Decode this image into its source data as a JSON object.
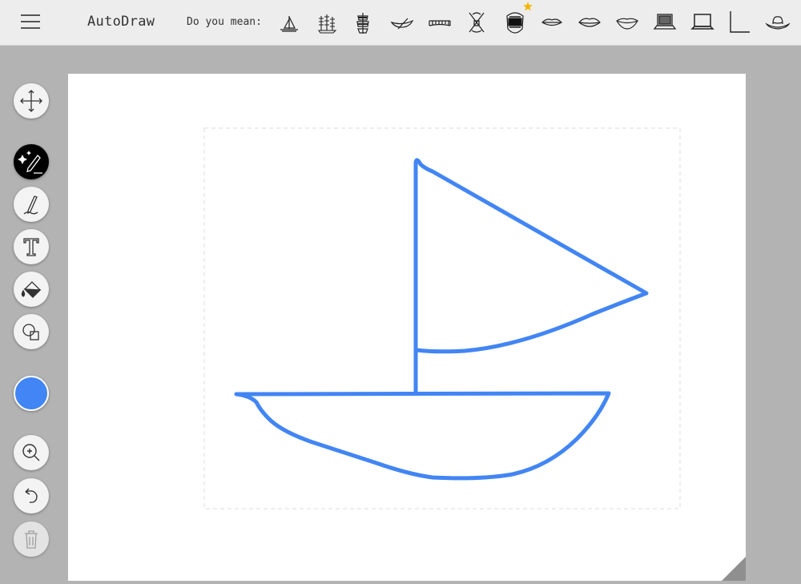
{
  "app": {
    "title": "AutoDraw"
  },
  "header": {
    "suggestions_label": "Do you mean:"
  },
  "suggestions": [
    {
      "icon": "sailboat-icon"
    },
    {
      "icon": "tall-ship-icon"
    },
    {
      "icon": "galleon-icon"
    },
    {
      "icon": "canoe-icon"
    },
    {
      "icon": "bridge-icon"
    },
    {
      "icon": "crossed-oars-icon"
    },
    {
      "icon": "open-mouth-icon",
      "featured": true
    },
    {
      "icon": "lips-icon"
    },
    {
      "icon": "closed-lips-icon"
    },
    {
      "icon": "smiling-lips-icon"
    },
    {
      "icon": "laptop-icon"
    },
    {
      "icon": "laptop-outline-icon"
    },
    {
      "icon": "corner-line-icon"
    },
    {
      "icon": "cowboy-hat-icon"
    }
  ],
  "toolbar": {
    "tools": [
      {
        "name": "move-tool",
        "icon": "move-arrows-icon"
      },
      {
        "name": "autodraw-tool",
        "icon": "magic-pen-icon",
        "active": true
      },
      {
        "name": "draw-tool",
        "icon": "pencil-icon"
      },
      {
        "name": "type-tool",
        "icon": "text-t-icon"
      },
      {
        "name": "fill-tool",
        "icon": "paint-bucket-icon"
      },
      {
        "name": "shape-tool",
        "icon": "shapes-icon"
      },
      {
        "name": "color-picker",
        "icon": "color-swatch-icon"
      },
      {
        "name": "zoom-tool",
        "icon": "zoom-in-icon"
      },
      {
        "name": "undo-button",
        "icon": "undo-icon"
      },
      {
        "name": "delete-button",
        "icon": "trash-icon",
        "disabled": true
      }
    ]
  },
  "colors": {
    "stroke": "#4285f4",
    "selected_color": "#4285f4",
    "toolbar_bg": "#ededed",
    "workspace_bg": "#b3b3b3",
    "star": "#f5b400"
  }
}
